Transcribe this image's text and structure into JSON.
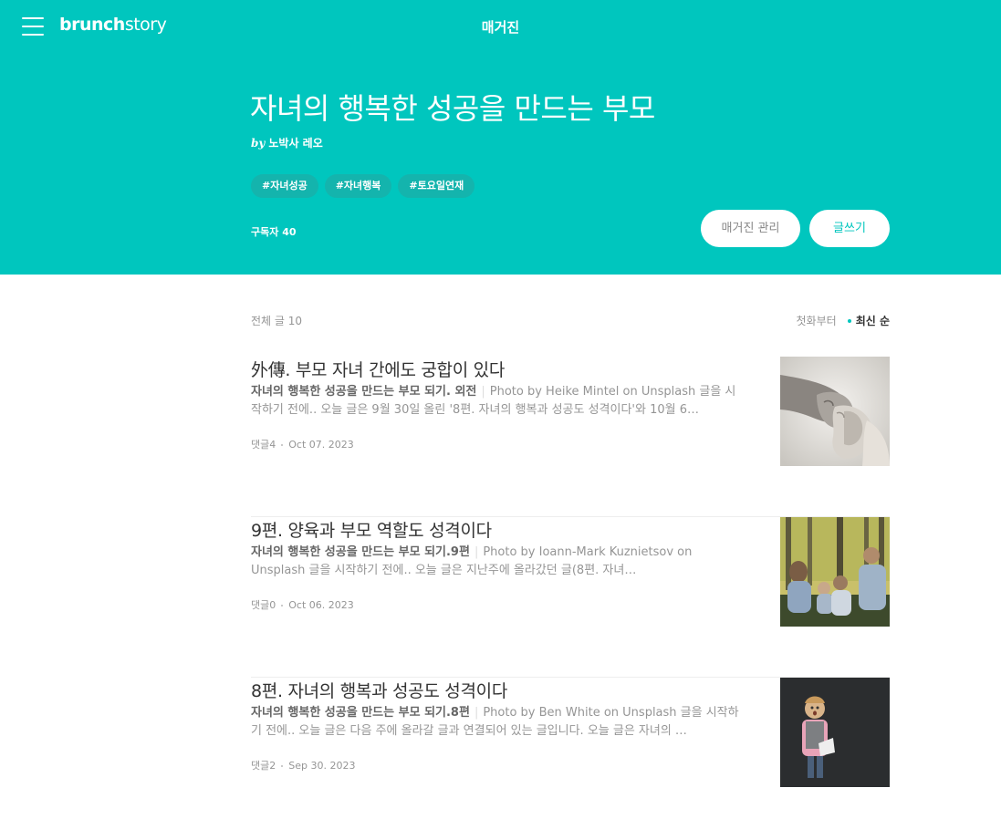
{
  "header": {
    "logo_brunch": "brunch",
    "logo_story": "story",
    "page_title": "매거진"
  },
  "magazine": {
    "title": "자녀의 행복한 성공을 만드는 부모",
    "by": "by",
    "author": "노박사 레오",
    "tags": [
      "#자녀성공",
      "#자녀행복",
      "#토요일연재"
    ],
    "subscribers": "구독자 40",
    "manage_label": "매거진 관리",
    "write_label": "글쓰기"
  },
  "list": {
    "count_label": "전체 글 10",
    "sort_first": "첫화부터",
    "sort_latest": "최신 순"
  },
  "articles": [
    {
      "title": "外傳. 부모 자녀 간에도 궁합이 있다",
      "subtitle": "자녀의 행복한 성공을 만드는 부모 되기. 외전",
      "excerpt": "Photo by Heike Mintel on Unsplash 글을 시작하기 전에.. 오늘 글은 9월 30일 올린 '8편. 자녀의 행복과 성공도 성격이다'와 10월 6…",
      "comments": "댓글4",
      "date": "Oct 07. 2023",
      "thumb_icon": "hands-photo"
    },
    {
      "title": "9편. 양육과 부모 역할도 성격이다",
      "subtitle": "자녀의 행복한 성공을 만드는 부모 되기.9편",
      "excerpt": "Photo by Ioann-Mark Kuznietsov on Unsplash 글을 시작하기 전에.. 오늘 글은 지난주에 올라갔던 글(8편. 자녀…",
      "comments": "댓글0",
      "date": "Oct 06. 2023",
      "thumb_icon": "family-photo"
    },
    {
      "title": "8편. 자녀의 행복과 성공도 성격이다",
      "subtitle": "자녀의 행복한 성공을 만드는 부모 되기.8편",
      "excerpt": "Photo by Ben White on Unsplash 글을 시작하기 전에.. 오늘 글은 다음 주에 올라갈 글과 연결되어 있는 글입니다. 오늘 글은 자녀의 …",
      "comments": "댓글2",
      "date": "Sep 30. 2023",
      "thumb_icon": "child-photo"
    }
  ],
  "colors": {
    "accent": "#00c6be",
    "tag_bg": "#14b4ad",
    "text": "#333333",
    "muted": "#959595"
  }
}
